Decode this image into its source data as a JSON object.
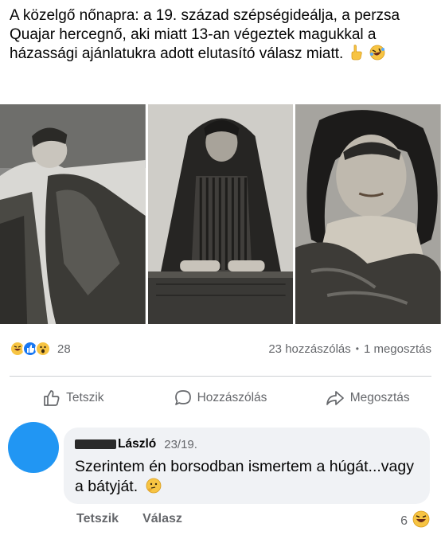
{
  "post": {
    "text": "A közelgő nőnapra: a 19. század szépségideálja, a perzsa Quajar hercegnő, aki miatt 13-an végeztek magukkal a házassági ajánlatukra adott elutasító válasz miatt.",
    "emojis": [
      "finger-emoji",
      "rofl-emoji"
    ]
  },
  "photos": [
    {
      "name": "photo-reclining-princess"
    },
    {
      "name": "photo-standing-princess"
    },
    {
      "name": "photo-portrait-princess"
    }
  ],
  "stats": {
    "reaction_count": "28",
    "comments": "23 hozzászólás",
    "separator": "•",
    "shares": "1 megosztás"
  },
  "actions": {
    "like": "Tetszik",
    "comment": "Hozzászólás",
    "share": "Megosztás"
  },
  "comment": {
    "author": "László",
    "time": "23/19.",
    "text": "Szerintem én borsodban ismertem a húgát...vagy a bátyját.",
    "like": "Tetszik",
    "reply": "Válasz",
    "reaction_count": "6"
  },
  "colors": {
    "avatar": "#2196f3",
    "like_blue": "#1877f2",
    "emoji_yellow": "#f7c443",
    "text_secondary": "#65676b",
    "bubble": "#f0f2f5"
  }
}
